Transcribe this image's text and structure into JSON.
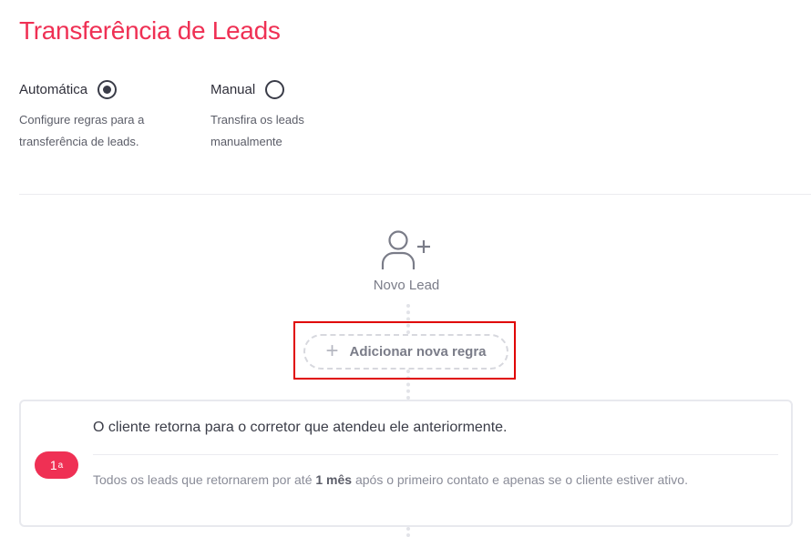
{
  "page": {
    "title": "Transferência de Leads",
    "accent_color": "#ef3054"
  },
  "modes": {
    "automatic": {
      "label": "Automática",
      "selected": true,
      "description": "Configure regras para a transferência de leads."
    },
    "manual": {
      "label": "Manual",
      "selected": false,
      "description": "Transfira os leads manualmente"
    }
  },
  "flow": {
    "new_lead_icon": "user-plus-icon",
    "new_lead_label": "Novo Lead",
    "add_rule_icon": "plus-icon",
    "add_rule_label": "Adicionar nova regra"
  },
  "rules": [
    {
      "badge": "1",
      "badge_suffix": "a",
      "title": "O cliente retorna para o corretor que atendeu ele anteriormente.",
      "desc_before": "Todos os leads que retornarem por até ",
      "desc_highlight": "1 mês",
      "desc_after": " após o primeiro contato e apenas se o cliente estiver ativo."
    }
  ]
}
